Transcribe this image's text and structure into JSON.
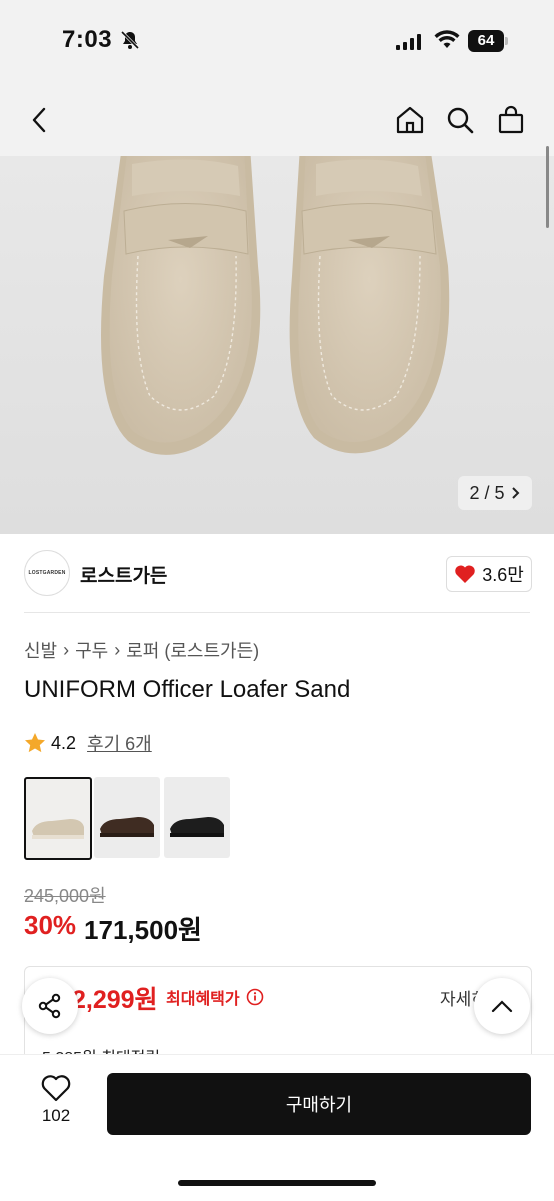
{
  "status_bar": {
    "time": "7:03",
    "battery": "64"
  },
  "nav": {
    "back_icon": "chevron-left-icon",
    "home_icon": "home-icon",
    "search_icon": "search-icon",
    "bag_icon": "shopping-bag-icon"
  },
  "gallery": {
    "pager": "2 / 5"
  },
  "brand": {
    "logo_text": "LOSTGARDEN",
    "name": "로스트가든",
    "likes": "3.6만"
  },
  "breadcrumb": [
    "신발",
    "구두",
    "로퍼 (로스트가든)"
  ],
  "product": {
    "title": "UNIFORM Officer Loafer Sand",
    "rating": "4.2",
    "reviews": "후기 6개",
    "variants": [
      "sand",
      "brown",
      "black"
    ],
    "original_price": "245,000원",
    "discount": "30%",
    "price": "171,500원"
  },
  "benefit": {
    "price": "2,299원",
    "label": "최대혜택가",
    "detail": "자세히",
    "points": "5,385원 최대적립"
  },
  "bottom_bar": {
    "wish_count": "102",
    "buy_label": "구매하기"
  },
  "colors": {
    "accent_red": "#e02020",
    "button_black": "#111111"
  }
}
